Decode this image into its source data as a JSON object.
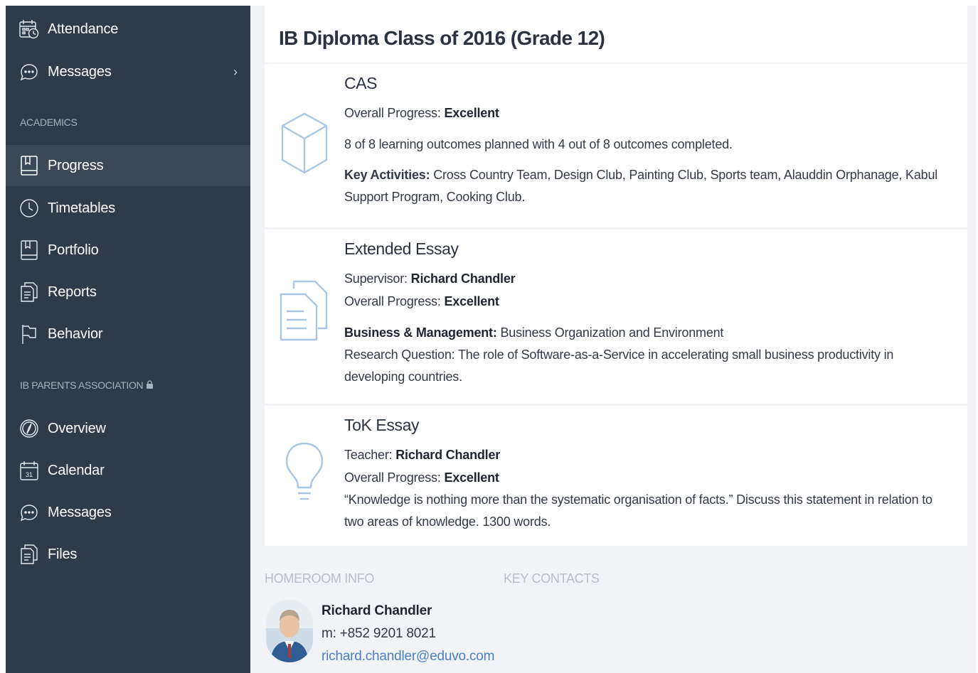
{
  "sidebar": {
    "items_top": [
      {
        "label": "Attendance",
        "icon": "attendance-calendar-icon"
      },
      {
        "label": "Messages",
        "icon": "chat-bubbles-icon",
        "chevron": "›"
      }
    ],
    "section_academics": "ACADEMICS",
    "items_academics": [
      {
        "label": "Progress",
        "icon": "notebook-icon",
        "active": true
      },
      {
        "label": "Timetables",
        "icon": "clock-icon"
      },
      {
        "label": "Portfolio",
        "icon": "portfolio-book-icon"
      },
      {
        "label": "Reports",
        "icon": "report-documents-icon"
      },
      {
        "label": "Behavior",
        "icon": "flag-icon"
      }
    ],
    "section_parents": "IB PARENTS ASSOCIATION",
    "items_parents": [
      {
        "label": "Overview",
        "icon": "compass-icon"
      },
      {
        "label": "Calendar",
        "icon": "calendar-icon",
        "day": "31"
      },
      {
        "label": "Messages",
        "icon": "chat-bubbles-icon"
      },
      {
        "label": "Files",
        "icon": "files-icon"
      }
    ]
  },
  "main": {
    "title": "IB Diploma Class of 2016 (Grade 12)",
    "cas": {
      "title": "CAS",
      "progress_label": "Overall Progress: ",
      "progress_value": "Excellent",
      "outcomes": "8 of 8 learning outcomes planned with 4 out of 8 outcomes completed.",
      "activities_label": "Key Activities:",
      "activities_value": " Cross Country Team, Design Club, Painting Club, Sports team, Alauddin Orphanage, Kabul Support Program, Cooking Club."
    },
    "ee": {
      "title": "Extended Essay",
      "supervisor_label": "Supervisor: ",
      "supervisor_value": "Richard Chandler",
      "progress_label": "Overall Progress: ",
      "progress_value": "Excellent",
      "subject_label": "Business & Management:",
      "subject_value": " Business Organization and Environment",
      "question": "Research Question: The role of Software-as-a-Service in accelerating small business productivity in developing countries."
    },
    "tok": {
      "title": "ToK Essay",
      "teacher_label": "Teacher: ",
      "teacher_value": "Richard Chandler",
      "progress_label": "Overall Progress: ",
      "progress_value": "Excellent",
      "prompt": "“Knowledge is nothing more than the systematic organisation of facts.” Discuss this statement in relation to two areas of knowledge. 1300 words."
    },
    "homeroom": {
      "heading": "HOMEROOM INFO",
      "name": "Richard Chandler",
      "phone": "m: +852 9201 8021",
      "email": "richard.chandler@eduvo.com"
    },
    "key_contacts_heading": "KEY CONTACTS"
  },
  "colors": {
    "sidebar_bg": "#2f3a4b",
    "sidebar_active": "#3c4758",
    "icon_blue": "#a9c6e8",
    "link_blue": "#4d7fc0",
    "main_bg": "#f1f3f6"
  }
}
